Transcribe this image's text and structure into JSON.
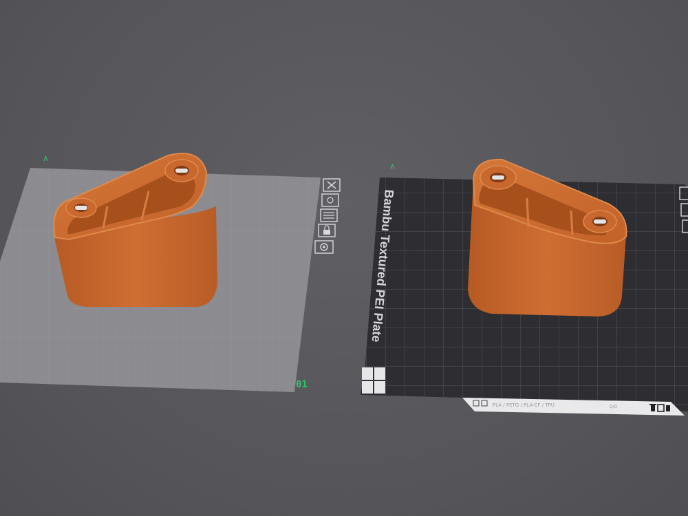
{
  "scene": {
    "plates": [
      {
        "id": "plate-1",
        "number_label": "01",
        "axis_marker": "∧"
      },
      {
        "id": "plate-2",
        "brand_label": "Bambu Textured PEI Plate",
        "axis_marker": "∧",
        "status_bar_text": "PLA / PETG / PLA-CF / TPU",
        "status_bar_right": "0/0",
        "status_icons": [
          "grid-icon",
          "copy-icon"
        ],
        "status_right_icons": [
          "trash-icon",
          "box-icon",
          "copy-icon"
        ]
      }
    ],
    "plate_tools": [
      {
        "name": "close-icon",
        "glyph": "✕"
      },
      {
        "name": "arrange-icon",
        "glyph": "☰"
      },
      {
        "name": "layout-icon",
        "glyph": "☷"
      },
      {
        "name": "lock-icon",
        "glyph": "🔒"
      },
      {
        "name": "settings-icon",
        "glyph": "◎"
      }
    ],
    "colors": {
      "background": "#57575c",
      "plate_light": "#8a8a8f",
      "plate_dark": "#2e2e33",
      "model_orange": "#c96a2e",
      "model_orange_dark": "#a9531f",
      "accent_green": "#34c36a"
    }
  }
}
